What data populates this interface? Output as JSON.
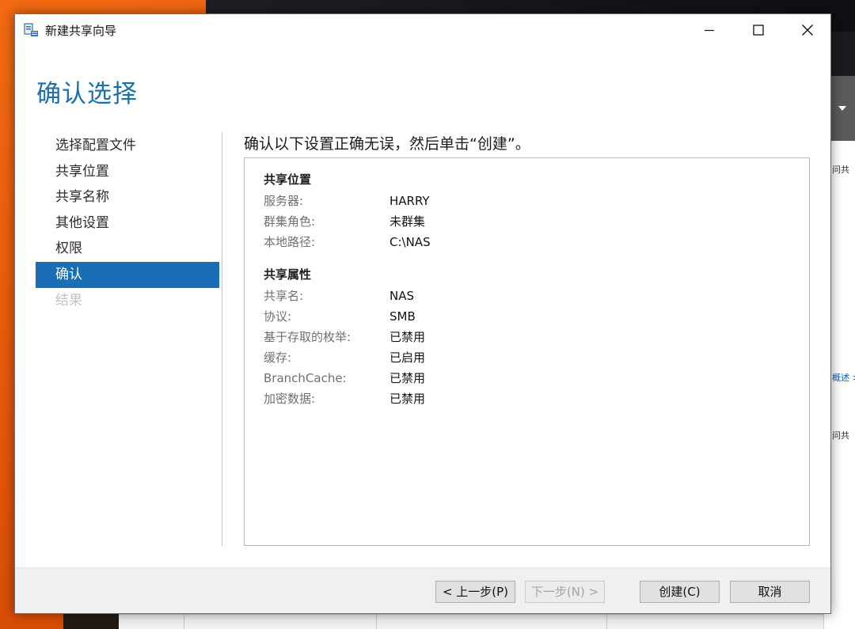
{
  "window": {
    "title": "新建共享向导",
    "minimize_icon": "minimize-icon",
    "maximize_icon": "maximize-icon",
    "close_icon": "close-icon"
  },
  "page": {
    "heading": "确认选择",
    "instruction": "确认以下设置正确无误，然后单击“创建”。"
  },
  "nav": {
    "items": [
      {
        "label": "选择配置文件",
        "state": "normal"
      },
      {
        "label": "共享位置",
        "state": "normal"
      },
      {
        "label": "共享名称",
        "state": "normal"
      },
      {
        "label": "其他设置",
        "state": "normal"
      },
      {
        "label": "权限",
        "state": "normal"
      },
      {
        "label": "确认",
        "state": "active"
      },
      {
        "label": "结果",
        "state": "disabled"
      }
    ],
    "active_color": "#1a6eb5"
  },
  "summary": {
    "location": {
      "title": "共享位置",
      "rows": [
        {
          "key": "服务器:",
          "value": "HARRY"
        },
        {
          "key": "群集角色:",
          "value": "未群集"
        },
        {
          "key": "本地路径:",
          "value": "C:\\NAS"
        }
      ]
    },
    "properties": {
      "title": "共享属性",
      "rows": [
        {
          "key": "共享名:",
          "value": "NAS"
        },
        {
          "key": "协议:",
          "value": "SMB"
        },
        {
          "key": "基于存取的枚举:",
          "value": "已禁用"
        },
        {
          "key": "缓存:",
          "value": "已启用"
        },
        {
          "key": "BranchCache:",
          "value": "已禁用"
        },
        {
          "key": "加密数据:",
          "value": "已禁用"
        }
      ]
    }
  },
  "buttons": {
    "prev": "< 上一步(P)",
    "next": "下一步(N) >",
    "create": "创建(C)",
    "cancel": "取消"
  },
  "background": {
    "peek_texts": [
      "问共",
      "概述 >",
      "问共"
    ]
  },
  "colors": {
    "heading": "#1b6fa5",
    "accent": "#1a6eb5"
  }
}
